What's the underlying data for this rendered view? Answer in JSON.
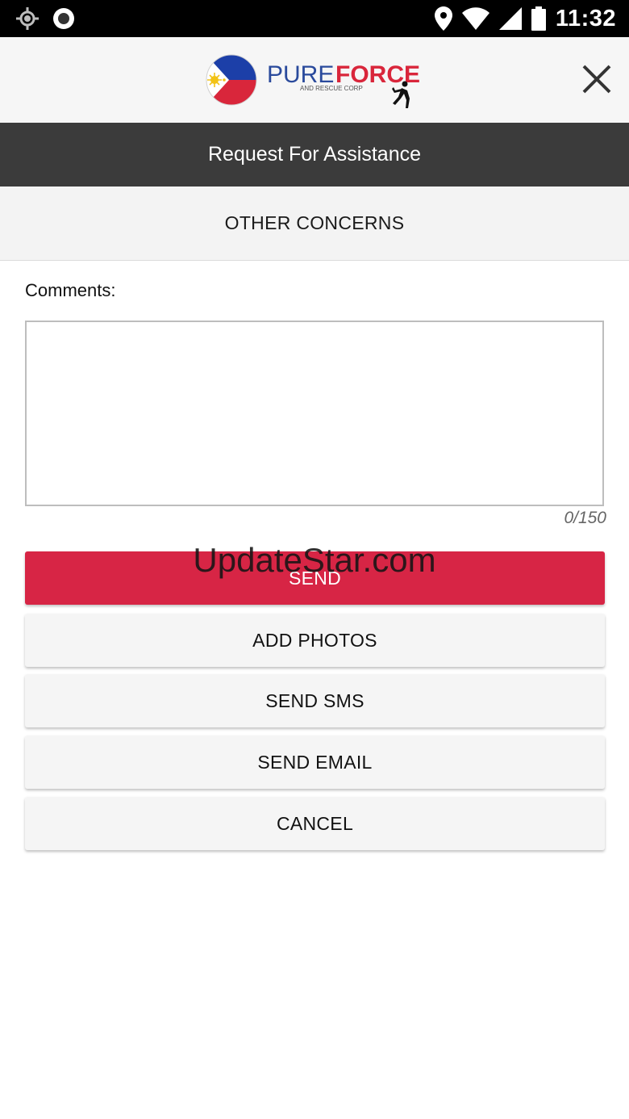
{
  "status_bar": {
    "time": "11:32",
    "icons": [
      "location-target-icon",
      "record-icon",
      "location-pin-icon",
      "wifi-icon",
      "signal-icon",
      "battery-icon"
    ]
  },
  "header": {
    "logo": {
      "brand_left": "PURE",
      "brand_right": "FORCE",
      "tagline": "AND RESCUE CORP"
    },
    "close_icon": "close-icon"
  },
  "title_bar": {
    "title": "Request For Assistance"
  },
  "sub_bar": {
    "label": "OTHER CONCERNS"
  },
  "form": {
    "comments_label": "Comments:",
    "comments_value": "",
    "counter": "0/150"
  },
  "buttons": {
    "send": "SEND",
    "add_photos": "ADD PHOTOS",
    "send_sms": "SEND SMS",
    "send_email": "SEND EMAIL",
    "cancel": "CANCEL"
  },
  "watermark": "UpdateStar.com",
  "colors": {
    "primary": "#d72545",
    "title_bar": "#3b3b3b",
    "header_bg": "#f6f6f6"
  }
}
